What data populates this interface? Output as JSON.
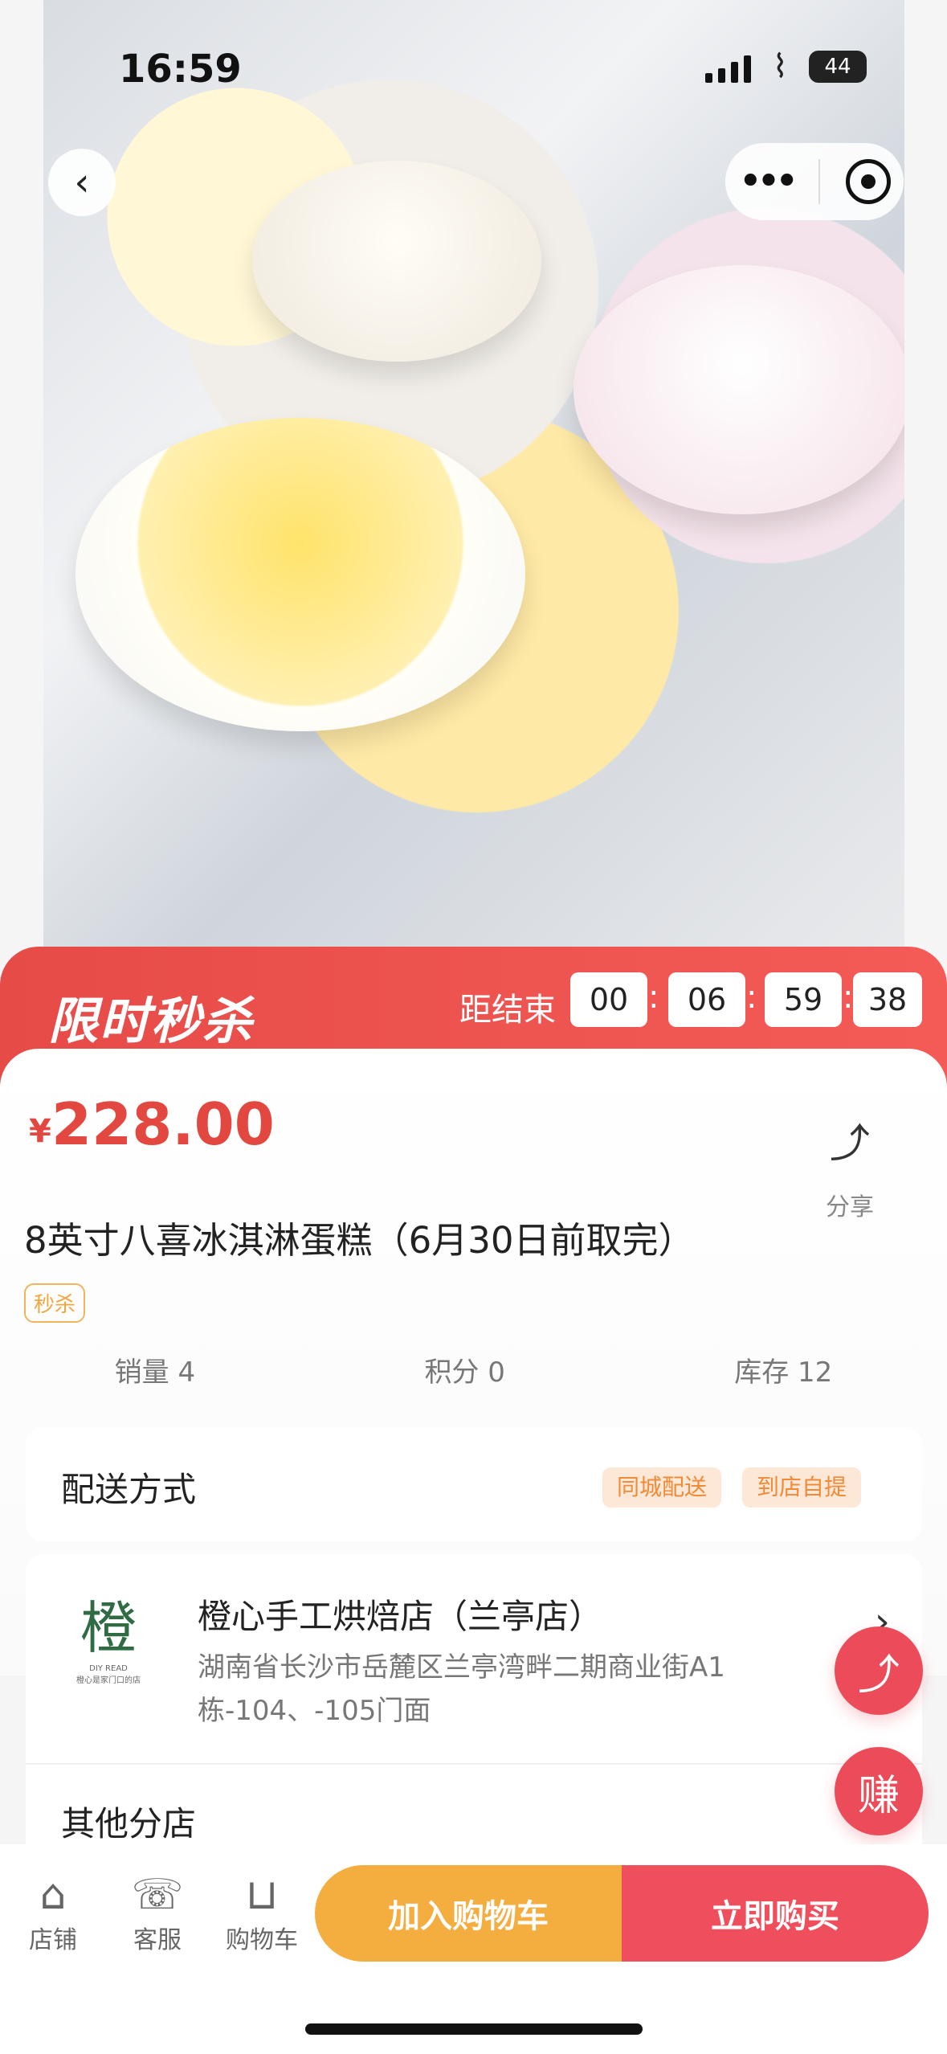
{
  "status_bar": {
    "time": "16:59",
    "battery": "44"
  },
  "hero": {
    "back_icon": "chevron-left-icon",
    "menu_icon": "more-horizontal-icon",
    "target_icon": "target-icon"
  },
  "flash_sale": {
    "title": "限时秒杀",
    "countdown_label": "距结束",
    "hours": "00",
    "minutes": "06",
    "seconds": "59",
    "centiseconds": "38"
  },
  "product": {
    "currency": "¥",
    "price": "228.00",
    "share_label": "分享",
    "title": "8英寸八喜冰淇淋蛋糕（6月30日前取完）",
    "tag": "秒杀",
    "sales": "销量 4",
    "points": "积分 0",
    "stock": "库存 12"
  },
  "delivery": {
    "label": "配送方式",
    "options": [
      "同城配送",
      "到店自提"
    ]
  },
  "store": {
    "logo_text": "橙",
    "logo_diy": "DIY READ",
    "logo_caption": "橙心是家门口的店",
    "name": "橙心手工烘焙店（兰亭店）",
    "address": "湖南省长沙市岳麓区兰亭湾畔二期商业街A1栋-104、-105门面",
    "other_branch": "其他分店"
  },
  "floating": {
    "share_icon": "share-icon",
    "earn_label": "赚"
  },
  "bottom_bar": {
    "store_label": "店铺",
    "service_label": "客服",
    "cart_label": "购物车",
    "add_cart_label": "加入购物车",
    "buy_label": "立即购买"
  },
  "colors": {
    "primary_red": "#e64b48",
    "accent_orange": "#f4ad3f",
    "buy_red": "#ef4f5c"
  }
}
